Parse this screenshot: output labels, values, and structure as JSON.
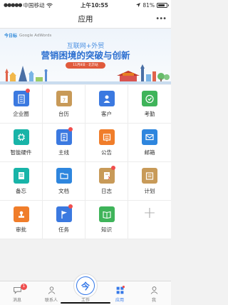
{
  "status": {
    "carrier": "中国移动",
    "signal_dots": "●●●●●",
    "time": "上午10:55",
    "battery": "81%",
    "battery_level": 0.81
  },
  "nav": {
    "title": "应用",
    "more": "•••"
  },
  "banner": {
    "brand": "今日标",
    "partner": "Google AdWords",
    "line1": "互联网+外贸",
    "line2": "营销困境的突破与创新",
    "pill": "11月8日 · 北京站"
  },
  "apps": [
    {
      "label": "企业圈",
      "icon": "building-icon",
      "color": "#3b79e0",
      "dot": true
    },
    {
      "label": "台历",
      "icon": "calendar-icon",
      "color": "#c89a58",
      "dot": false
    },
    {
      "label": "客户",
      "icon": "customer-icon",
      "color": "#3b79e0",
      "dot": false
    },
    {
      "label": "考勤",
      "icon": "clock-check-icon",
      "color": "#3fb45a",
      "dot": false
    },
    {
      "label": "智能硬件",
      "icon": "chip-icon",
      "color": "#18b4a8",
      "dot": false
    },
    {
      "label": "主线",
      "icon": "list-icon",
      "color": "#3b79e0",
      "dot": true
    },
    {
      "label": "公告",
      "icon": "announcement-icon",
      "color": "#f07d2a",
      "dot": false
    },
    {
      "label": "邮箱",
      "icon": "mail-icon",
      "color": "#2e86de",
      "dot": false
    },
    {
      "label": "备忘",
      "icon": "memo-icon",
      "color": "#18b4a8",
      "dot": false
    },
    {
      "label": "文档",
      "icon": "folder-icon",
      "color": "#2e86de",
      "dot": false
    },
    {
      "label": "日志",
      "icon": "journal-icon",
      "color": "#c89a58",
      "dot": true
    },
    {
      "label": "计划",
      "icon": "plan-icon",
      "color": "#c89a58",
      "dot": false
    },
    {
      "label": "审批",
      "icon": "stamp-icon",
      "color": "#f07d2a",
      "dot": false
    },
    {
      "label": "任务",
      "icon": "flag-icon",
      "color": "#3b79e0",
      "dot": true
    },
    {
      "label": "知识",
      "icon": "book-icon",
      "color": "#3fb45a",
      "dot": false
    }
  ],
  "tabs": [
    {
      "label": "消息",
      "icon": "chat-icon",
      "badge": "1"
    },
    {
      "label": "联系人",
      "icon": "contacts-icon",
      "badge": ""
    },
    {
      "label": "工作",
      "icon": "work-icon",
      "badge": ""
    },
    {
      "label": "应用",
      "icon": "apps-grid-icon",
      "badge": ""
    },
    {
      "label": "我",
      "icon": "profile-icon",
      "badge": ""
    }
  ],
  "work_glyph": "今",
  "colors": {
    "accent": "#3478e8",
    "badge": "#f04e4e"
  }
}
